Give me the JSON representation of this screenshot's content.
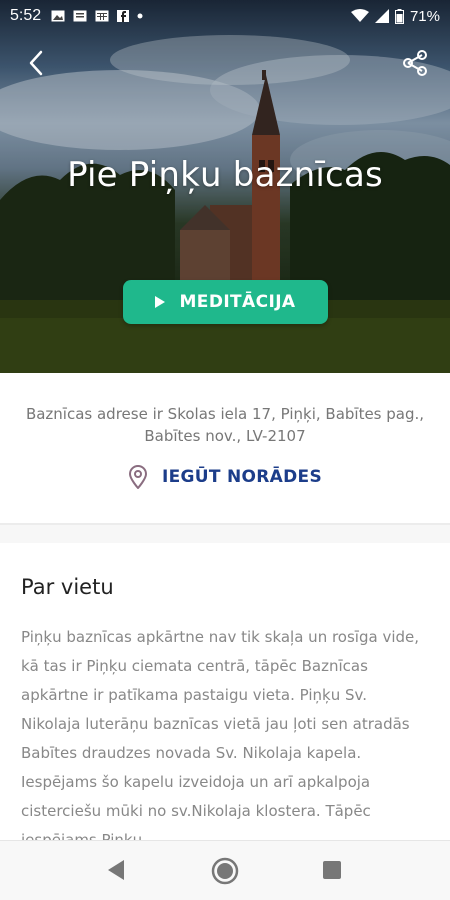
{
  "status_bar": {
    "time": "5:52",
    "notification_icons": [
      "image-icon",
      "message-icon",
      "calendar-icon",
      "facebook-icon",
      "dot-icon"
    ],
    "battery_percent": "71%"
  },
  "header": {
    "title": "Pie Piņķu baznīcas",
    "meditation_button_label": "MEDITĀCIJA"
  },
  "address": {
    "text": "Baznīcas adrese ir Skolas iela 17, Piņķi, Babītes pag., Babītes nov., LV-2107",
    "directions_label": "IEGŪT NORĀDES"
  },
  "about": {
    "heading": "Par vietu",
    "body": "Piņķu baznīcas apkārtne nav tik skaļa un rosīga vide, kā tas ir Piņķu ciemata centrā, tāpēc Baznīcas apkārtne ir patīkama pastaigu vieta. Piņķu Sv. Nikolaja luterāņu baznīcas vietā jau ļoti sen atradās Babītes draudzes novada Sv. Nikolaja kapela. Iespējams šo kapelu izveidoja un arī apkalpoja cisterciešu mūki no sv.Nikolaja klostera. Tāpēc iespējams Piņķu"
  },
  "colors": {
    "accent_green": "#1fb88c",
    "link_blue": "#1c3d8a"
  }
}
